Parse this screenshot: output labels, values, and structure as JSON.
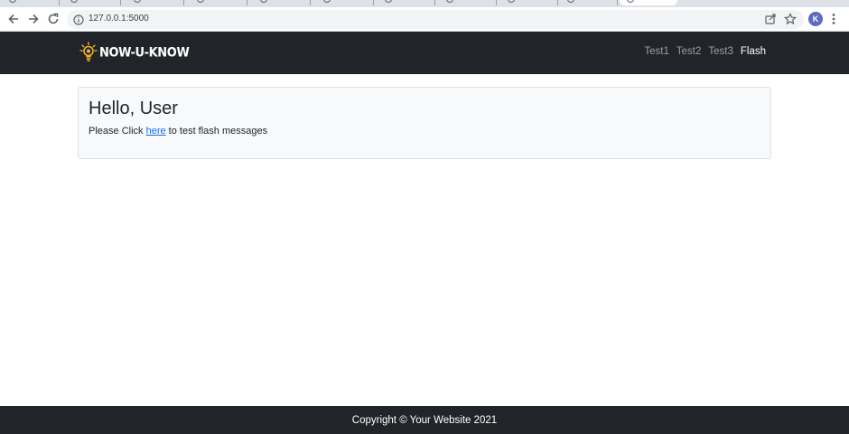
{
  "browser": {
    "url": "127.0.0.1:5000",
    "profile_initial": "K"
  },
  "site": {
    "brand": "NOW-U-KNOW",
    "nav": [
      "Test1",
      "Test2",
      "Test3",
      "Flash"
    ],
    "active_nav": "Flash"
  },
  "card": {
    "heading": "Hello, User",
    "text_before": "Please Click ",
    "link": "here",
    "text_after": " to test flash messages"
  },
  "footer": {
    "text": "Copyright © Your Website 2021"
  },
  "colors": {
    "navbar": "#212529",
    "link": "#0d6efd",
    "card_bg": "#f8f9fa",
    "bulb": "#f2b632"
  }
}
